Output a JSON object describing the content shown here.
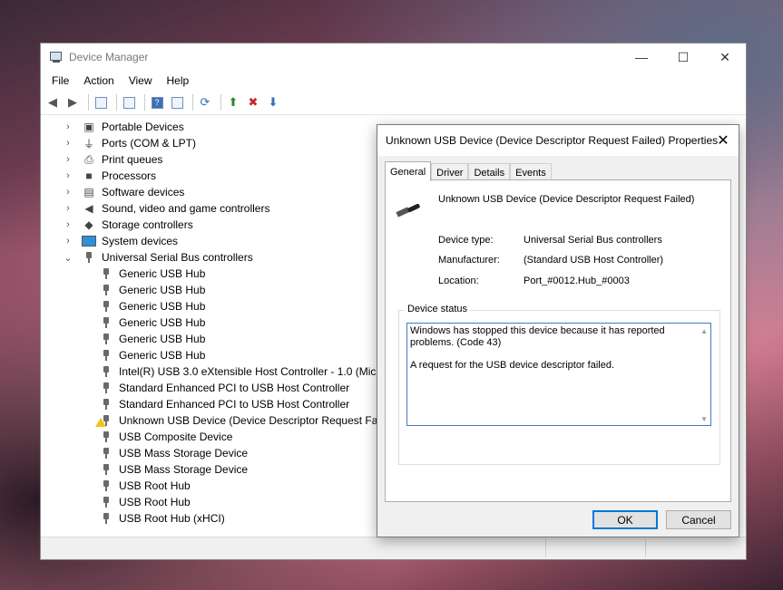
{
  "window": {
    "title": "Device Manager",
    "controls": [
      "—",
      "☐",
      "✕"
    ]
  },
  "menu": [
    "File",
    "Action",
    "View",
    "Help"
  ],
  "tree": {
    "categories": [
      {
        "label": "Portable Devices",
        "icon": "portable-icon",
        "expanded": false
      },
      {
        "label": "Ports (COM & LPT)",
        "icon": "port-icon",
        "expanded": false
      },
      {
        "label": "Print queues",
        "icon": "printer-icon",
        "expanded": false
      },
      {
        "label": "Processors",
        "icon": "processor-icon",
        "expanded": false
      },
      {
        "label": "Software devices",
        "icon": "software-icon",
        "expanded": false
      },
      {
        "label": "Sound, video and game controllers",
        "icon": "speaker-icon",
        "expanded": false
      },
      {
        "label": "Storage controllers",
        "icon": "storage-icon",
        "expanded": false
      },
      {
        "label": "System devices",
        "icon": "monitor-icon",
        "expanded": false
      },
      {
        "label": "Universal Serial Bus controllers",
        "icon": "usb-icon",
        "expanded": true
      }
    ],
    "usb_children": [
      {
        "label": "Generic USB Hub",
        "warning": false
      },
      {
        "label": "Generic USB Hub",
        "warning": false
      },
      {
        "label": "Generic USB Hub",
        "warning": false
      },
      {
        "label": "Generic USB Hub",
        "warning": false
      },
      {
        "label": "Generic USB Hub",
        "warning": false
      },
      {
        "label": "Generic USB Hub",
        "warning": false
      },
      {
        "label": "Intel(R) USB 3.0 eXtensible Host Controller - 1.0 (Micros",
        "warning": false
      },
      {
        "label": "Standard Enhanced PCI to USB Host Controller",
        "warning": false
      },
      {
        "label": "Standard Enhanced PCI to USB Host Controller",
        "warning": false
      },
      {
        "label": "Unknown USB Device (Device Descriptor Request Failed",
        "warning": true
      },
      {
        "label": "USB Composite Device",
        "warning": false
      },
      {
        "label": "USB Mass Storage Device",
        "warning": false
      },
      {
        "label": "USB Mass Storage Device",
        "warning": false
      },
      {
        "label": "USB Root Hub",
        "warning": false
      },
      {
        "label": "USB Root Hub",
        "warning": false
      },
      {
        "label": "USB Root Hub (xHCI)",
        "warning": false
      }
    ]
  },
  "dialog": {
    "title": "Unknown USB Device (Device Descriptor Request Failed) Properties",
    "tabs": [
      "General",
      "Driver",
      "Details",
      "Events"
    ],
    "device_name": "Unknown USB Device (Device Descriptor Request Failed)",
    "properties": [
      {
        "key": "Device type:",
        "value": "Universal Serial Bus controllers"
      },
      {
        "key": "Manufacturer:",
        "value": "(Standard USB Host Controller)"
      },
      {
        "key": "Location:",
        "value": "Port_#0012.Hub_#0003"
      }
    ],
    "status_label": "Device status",
    "status_text": "Windows has stopped this device because it has reported problems. (Code 43)\n\nA request for the USB device descriptor failed.",
    "ok_label": "OK",
    "cancel_label": "Cancel"
  },
  "colors": {
    "accent": "#0078d7",
    "warning": "#f2c21b"
  }
}
